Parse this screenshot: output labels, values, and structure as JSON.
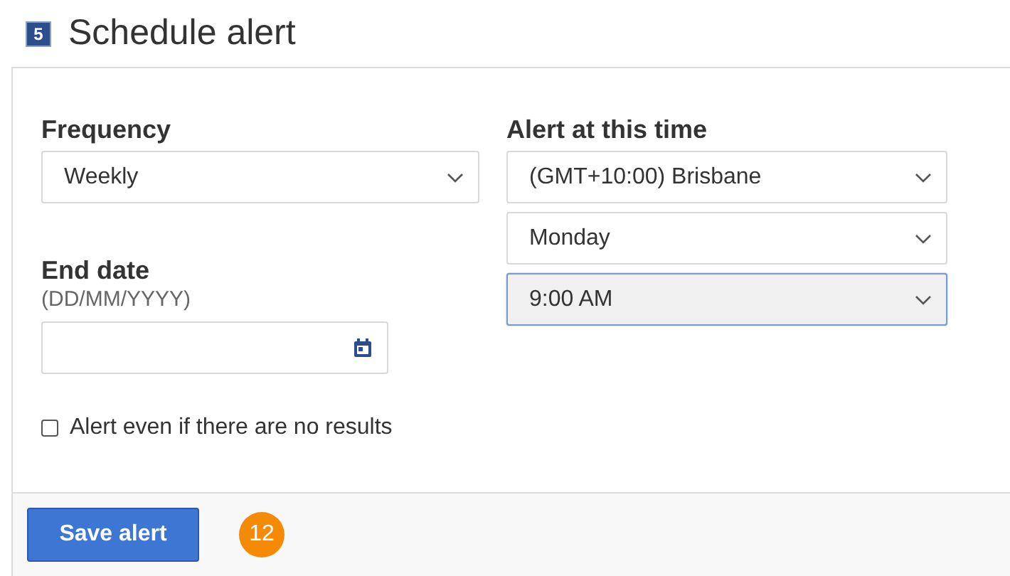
{
  "section": {
    "number": "5",
    "title": "Schedule alert"
  },
  "frequency": {
    "label": "Frequency",
    "value": "Weekly"
  },
  "end_date": {
    "label": "End date",
    "hint": "(DD/MM/YYYY)"
  },
  "alert_time": {
    "label": "Alert at this time",
    "selects": [
      {
        "value": "(GMT+10:00) Brisbane",
        "focused": false
      },
      {
        "value": "Monday",
        "focused": false
      },
      {
        "value": "9:00 AM",
        "focused": true
      }
    ]
  },
  "no_results_option": {
    "label": "Alert even if there are no results",
    "checked": false
  },
  "save_button": "Save alert",
  "step_badge": "12"
}
